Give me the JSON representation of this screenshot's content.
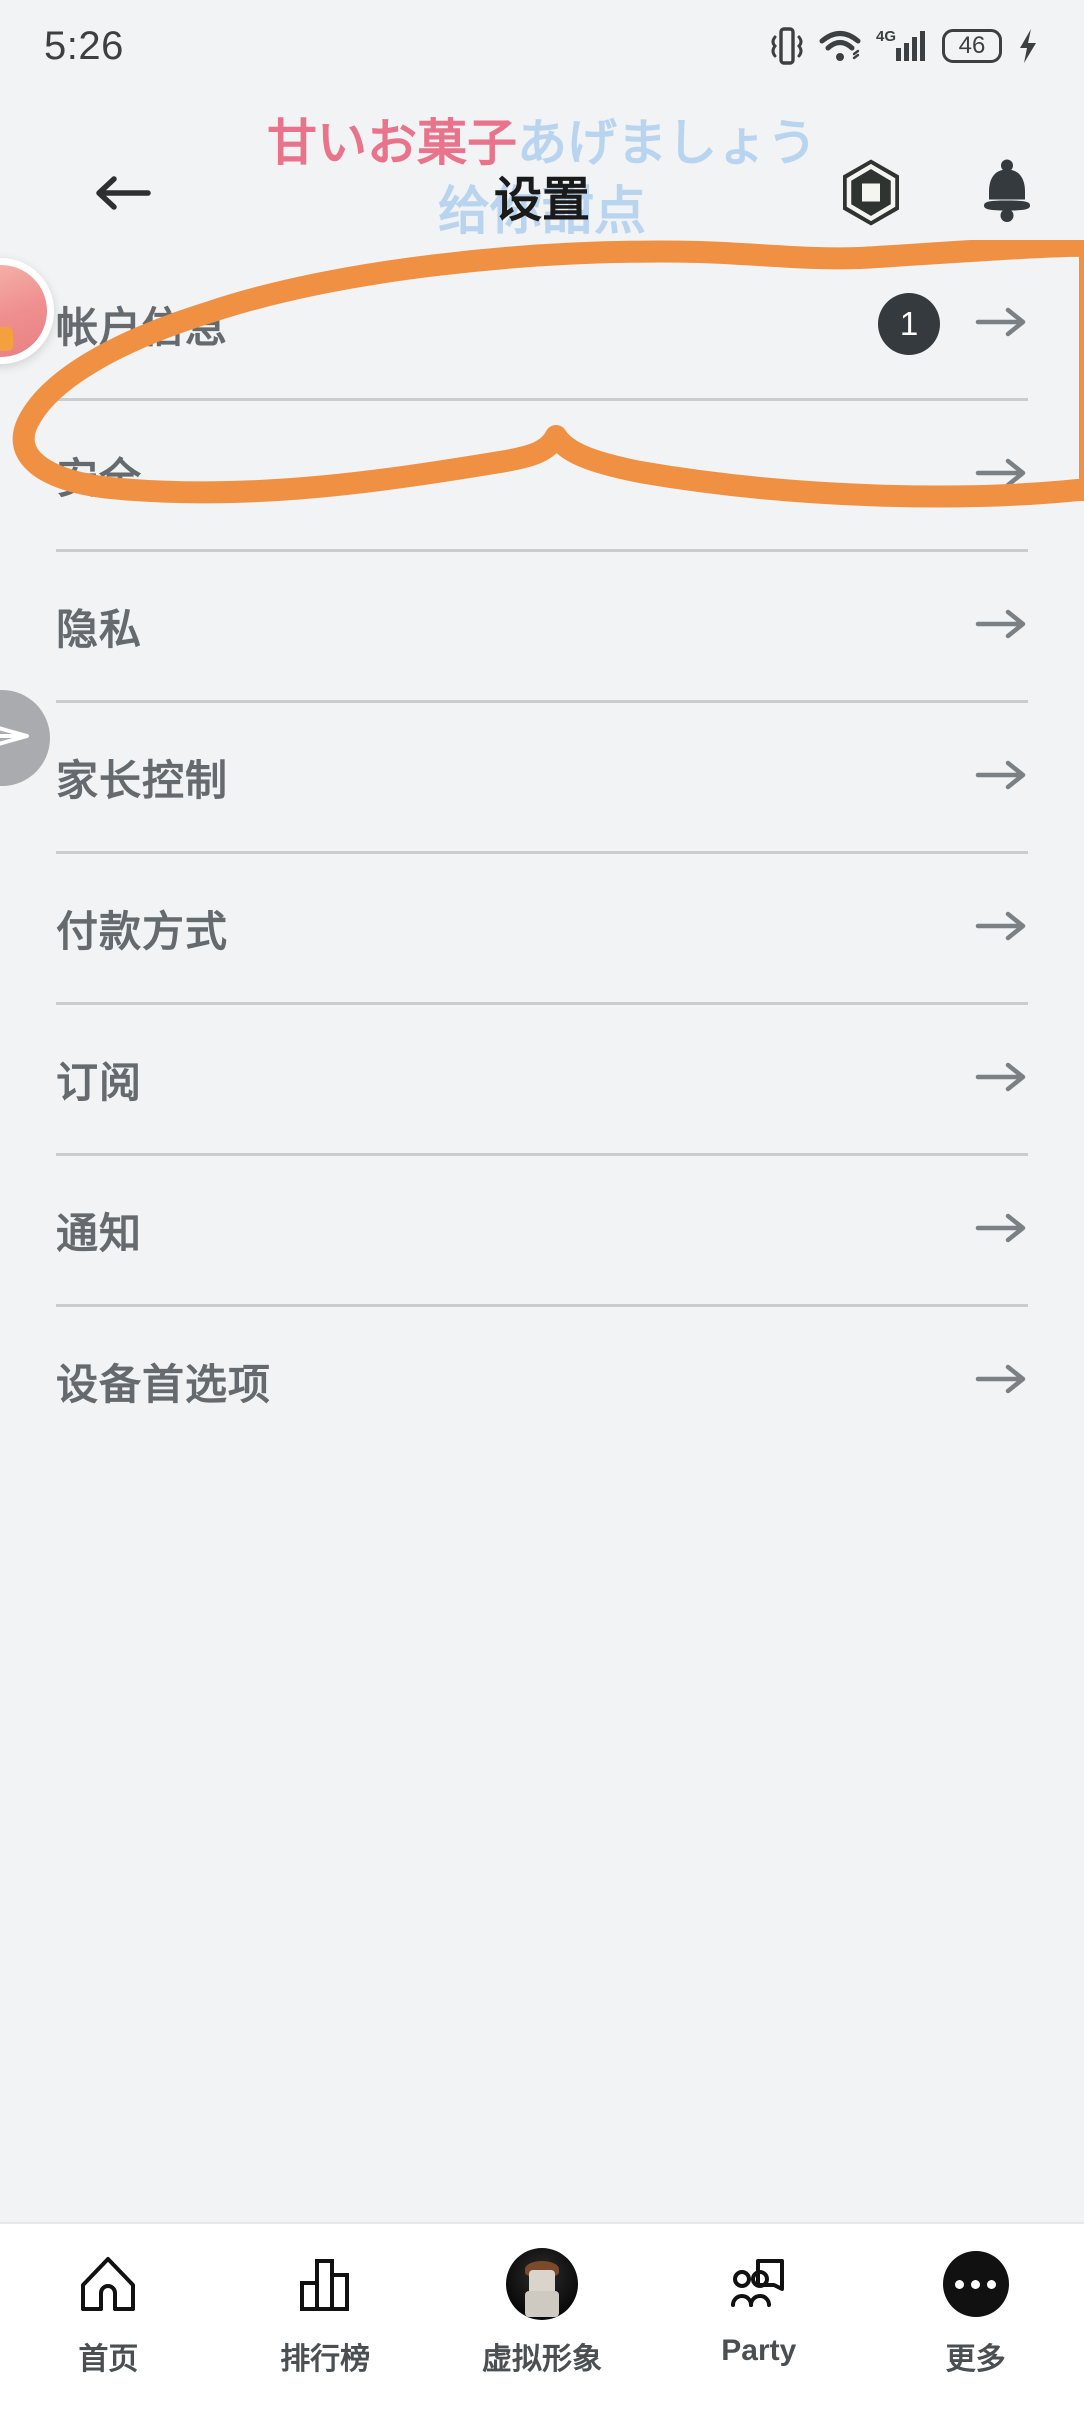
{
  "status_bar": {
    "time": "5:26",
    "icons": [
      "vibrate-icon",
      "wifi-icon",
      "signal-4g-icon",
      "battery-icon",
      "charging-bolt-icon"
    ],
    "network_label": "4G",
    "battery_level": "46"
  },
  "watermark": {
    "line1_part1": "甘いお菓子",
    "line1_part2": "あげましょう",
    "line2": "给你甜点",
    "color_pink": "#e8738a",
    "color_blue": "#b9d4ef"
  },
  "appbar": {
    "back_icon": "arrow-left-icon",
    "title": "设置",
    "logo_icon": "roblox-logo-icon",
    "bell_icon": "notification-bell-icon"
  },
  "floating": {
    "avatar_bubble": "avatar-bubble",
    "send_bubble": "send-arrow-bubble"
  },
  "annotation": {
    "color": "#ef9043",
    "shape": "hand-drawn-circle",
    "targets_row": "帐户信息"
  },
  "settings": {
    "rows": [
      {
        "label": "帐户信息",
        "badge": "1",
        "chevron": "arrow-right-icon"
      },
      {
        "label": "安全",
        "badge": "",
        "chevron": "arrow-right-icon"
      },
      {
        "label": "隐私",
        "badge": "",
        "chevron": "arrow-right-icon"
      },
      {
        "label": "家长控制",
        "badge": "",
        "chevron": "arrow-right-icon"
      },
      {
        "label": "付款方式",
        "badge": "",
        "chevron": "arrow-right-icon"
      },
      {
        "label": "订阅",
        "badge": "",
        "chevron": "arrow-right-icon"
      },
      {
        "label": "通知",
        "badge": "",
        "chevron": "arrow-right-icon"
      },
      {
        "label": "设备首选项",
        "badge": "",
        "chevron": "arrow-right-icon"
      }
    ]
  },
  "bottom_nav": {
    "items": [
      {
        "label": "首页",
        "icon": "home-icon"
      },
      {
        "label": "排行榜",
        "icon": "bar-chart-icon"
      },
      {
        "label": "虚拟形象",
        "icon": "avatar-icon"
      },
      {
        "label": "Party",
        "icon": "party-icon"
      },
      {
        "label": "更多",
        "icon": "more-dots-icon"
      }
    ]
  },
  "colors": {
    "page_background": "#f1f3f4",
    "text_primary": "#656a6e",
    "divider": "#c9cdd0",
    "badge_background": "#343a3d",
    "annotation_orange": "#ef9043"
  }
}
